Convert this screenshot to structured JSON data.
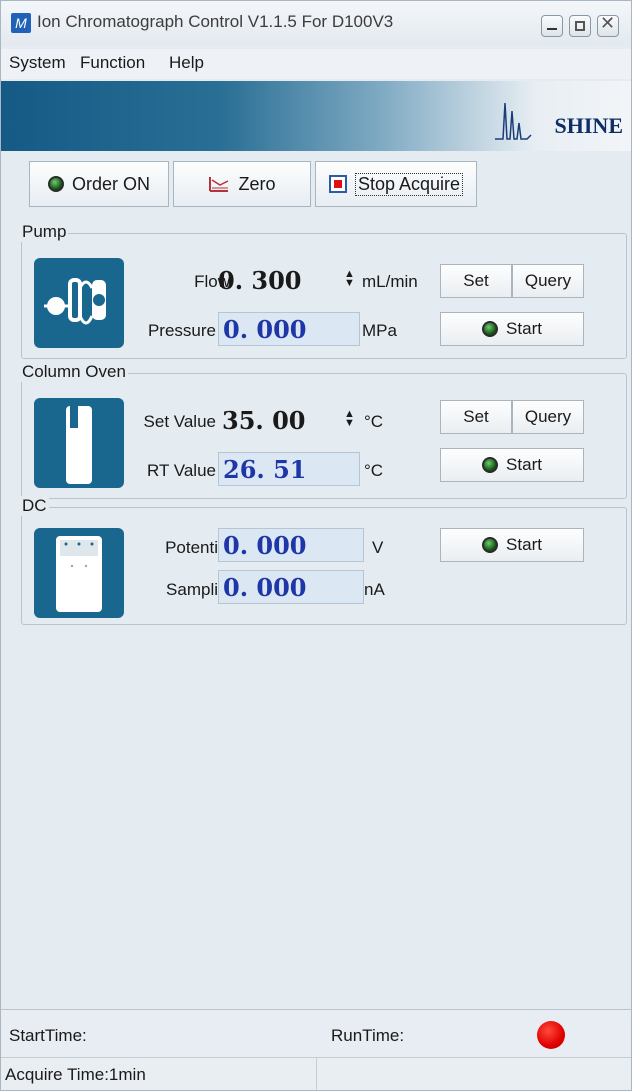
{
  "window": {
    "title": "Ion Chromatograph Control V1.1.5 For D100V3",
    "app_icon": "M"
  },
  "menu": {
    "items": [
      "System",
      "Function",
      "Help"
    ]
  },
  "banner": {
    "logo_text": "SHINE"
  },
  "toolbar": {
    "order_label": "Order ON",
    "zero_label": "Zero",
    "stop_label": "Stop Acquire"
  },
  "pump": {
    "title": "Pump",
    "flow_label": "Flow",
    "flow_value": "0. 300",
    "flow_unit": "mL/min",
    "pressure_label": "Pressure",
    "pressure_value": "0. 000",
    "pressure_unit": "MPa",
    "set_label": "Set",
    "query_label": "Query",
    "start_label": "Start"
  },
  "oven": {
    "title": "Column Oven",
    "set_value_label": "Set Value",
    "set_value": "35. 00",
    "set_unit": "°C",
    "rt_label": "RT Value",
    "rt_value": "26. 51",
    "rt_unit": "°C",
    "set_label": "Set",
    "query_label": "Query",
    "start_label": "Start"
  },
  "dc": {
    "title": "DC",
    "potential_label": "Potenti",
    "potential_value": "0. 000",
    "potential_unit": "V",
    "sampling_label": "Sampli",
    "sampling_value": "0. 000",
    "sampling_unit": "nA",
    "start_label": "Start"
  },
  "status": {
    "start_time_label": "StartTime:",
    "run_time_label": "RunTime:",
    "acquire_time": "Acquire Time:1min",
    "indicator_color": "#e00000"
  }
}
